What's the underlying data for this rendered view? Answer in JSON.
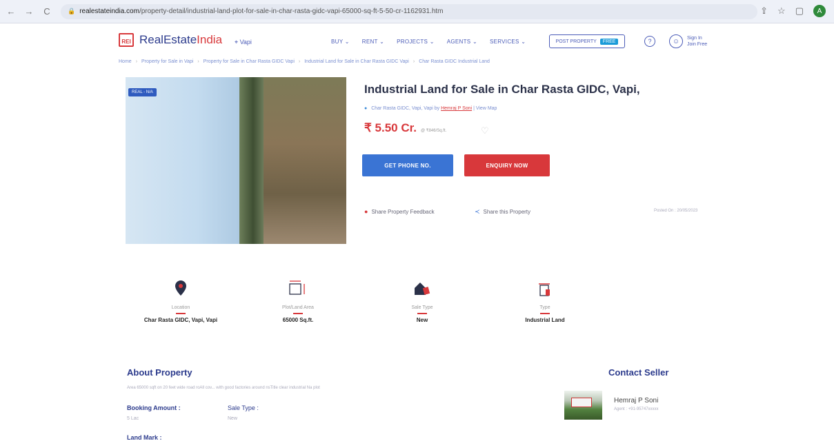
{
  "browser": {
    "url_host": "realestateindia.com",
    "url_path": "/property-detail/industrial-land-plot-for-sale-in-char-rasta-gidc-vapi-65000-sq-ft-5-50-cr-1162931.htm",
    "avatar_letter": "A"
  },
  "header": {
    "logo_mark": "REI",
    "logo_part1": "RealEstate",
    "logo_part2": "India",
    "city": "Vapi",
    "menu": [
      "BUY",
      "RENT",
      "PROJECTS",
      "AGENTS",
      "SERVICES"
    ],
    "post_property": "POST PROPERTY",
    "free_badge": "FREE",
    "sign_in": "Sign In",
    "join_free": "Join Free"
  },
  "breadcrumb": [
    "Home",
    "Property for Sale in Vapi",
    "Property for Sale in Char Rasta GIDC Vapi",
    "Industrial Land for Sale in Char Rasta GIDC Vapi",
    "Char Rasta GIDC Industrial Land"
  ],
  "photo": {
    "badge": "REAL - N/A"
  },
  "property": {
    "title": "Industrial Land for Sale in Char Rasta GIDC, Vapi,",
    "location": "Char Rasta GIDC, Vapi, Vapi by",
    "agent_link": "Hemraj P Soni",
    "view_map": "View Map",
    "price": "₹ 5.50 Cr.",
    "rate": "@ ₹846/Sq.ft.",
    "get_phone": "GET PHONE NO.",
    "enquiry": "ENQUIRY NOW",
    "feedback": "Share Property Feedback",
    "share": "Share this Property",
    "posted_on": "Posted On : 20/05/2023"
  },
  "facts": [
    {
      "label": "Location",
      "value": "Char Rasta GIDC, Vapi, Vapi",
      "icon": "location-pin-icon"
    },
    {
      "label": "Plot/Land Area",
      "value": "65000 Sq.ft.",
      "icon": "area-icon"
    },
    {
      "label": "Sale Type",
      "value": "New",
      "icon": "house-icon"
    },
    {
      "label": "Type",
      "value": "Industrial Land",
      "icon": "building-icon"
    }
  ],
  "about": {
    "heading": "About Property",
    "text": "Area 65000 sqft on 20 feet wide road roAll cov... with good factories around nsTitle clear industrial Na plot",
    "booking_label": "Booking Amount :",
    "booking_value": "5 Lac",
    "sale_type_label": "Sale Type :",
    "sale_type_value": "New",
    "land_mark_label": "Land Mark :"
  },
  "contact": {
    "heading": "Contact Seller",
    "name": "Hemraj P Soni",
    "sub": "Agent : +91-95747xxxxx"
  }
}
